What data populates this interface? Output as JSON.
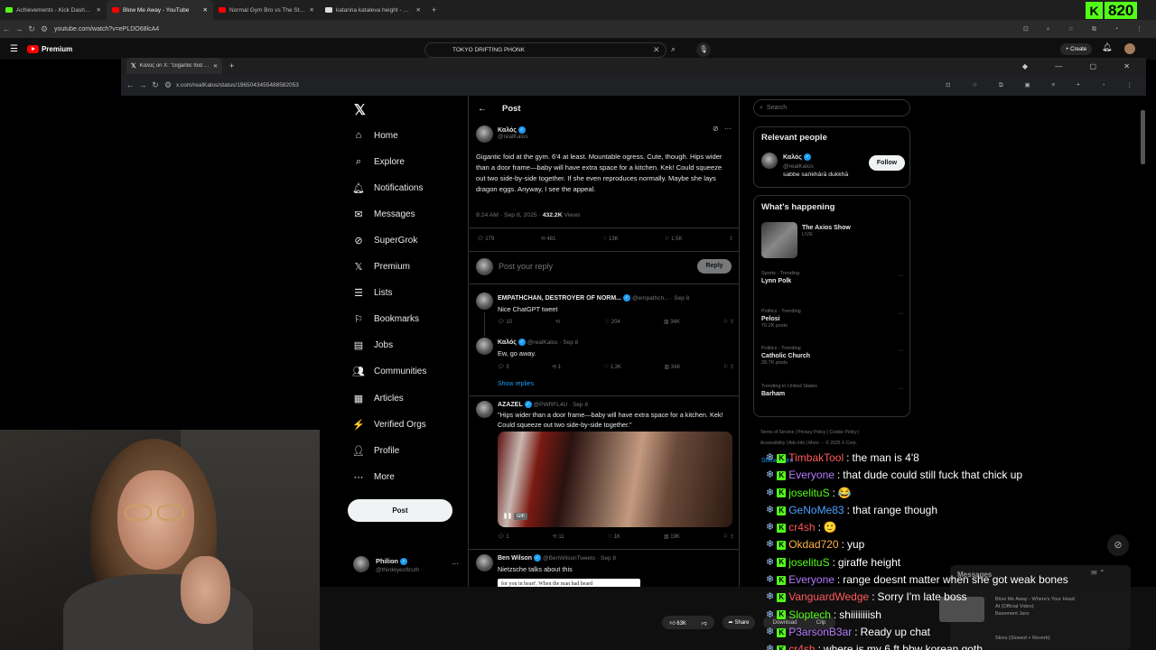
{
  "outer_tabs": [
    {
      "title": "Achievements - Kick Dashboard",
      "color": "#53fc18",
      "active": false
    },
    {
      "title": "Blow Me Away - YouTube",
      "color": "#ff0000",
      "active": true
    },
    {
      "title": "Normal Gym Bro vs The Strong...",
      "color": "#ff0000",
      "active": false
    },
    {
      "title": "katarina kataleva height - Goo...",
      "color": "#ddd",
      "active": false
    }
  ],
  "outer_url": "youtube.com/watch?v=ePLDO68lcA4",
  "kick": {
    "logo": "K",
    "count": "820"
  },
  "youtube": {
    "brand": "Premium",
    "search_value": "TOKYO DRIFTING PHONK",
    "create_label": "Create"
  },
  "inner_tab": {
    "title": "Καλός on X: \"Gigantic foid at th..."
  },
  "inner_url": "x.com/realKalos/status/1965043455488582053",
  "xnav": {
    "items": [
      "Home",
      "Explore",
      "Notifications",
      "Messages",
      "SuperGrok",
      "Premium",
      "Lists",
      "Bookmarks",
      "Jobs",
      "Communities",
      "Articles",
      "Verified Orgs",
      "Profile",
      "More"
    ],
    "post_button": "Post"
  },
  "account": {
    "name": "Philion",
    "handle": "@thirdeyeoftruth"
  },
  "post": {
    "header": "Post",
    "author": "Καλός",
    "handle": "@realKalos",
    "text": "Gigantic foid at the gym. 6'4 at least. Mountable ogress. Cute, though. Hips wider than a door frame—baby will have extra space for a kitchen. Kek! Could squeeze out two side-by-side together. If she even reproduces normally. Maybe she lays dragon eggs. Anyway, I see the appeal.",
    "time": "9:24 AM · Sep 8, 2025 · ",
    "views": "432.2K",
    "views_label": " Views",
    "replies": "179",
    "reposts": "481",
    "likes": "13K",
    "bookmarks": "1.5K",
    "reply_placeholder": "Post your reply",
    "reply_button": "Reply"
  },
  "replies": [
    {
      "name": "EMPATHCHAN, DESTROYER OF NORM...",
      "handle": "@empathch... · Sep 8",
      "text": "Nice ChatGPT tweet",
      "c": "10",
      "r": "",
      "l": "204",
      "v": "34K"
    },
    {
      "name": "Καλός",
      "handle": "@realKalos · Sep 8",
      "text": "Ew, go away.",
      "c": "3",
      "r": "1",
      "l": "1.3K",
      "v": "34K",
      "show_replies": "Show replies"
    },
    {
      "name": "AZAZEL",
      "handle": "@PWRFL4U · Sep 8",
      "text": "\"Hips wider than a door frame—baby will have extra space for a kitchen. Kek! Could squeeze out two side-by-side together.\"",
      "gif": "GIF",
      "c": "1",
      "r": "11",
      "l": "1K",
      "v": "19K"
    },
    {
      "name": "Ben Wilson",
      "handle": "@BenWilsonTweets · Sep 8",
      "text": "Nietzsche talks about this",
      "quote": "for you in heart'. When the man had heard"
    }
  ],
  "right": {
    "search_placeholder": "Search",
    "relevant_title": "Relevant people",
    "person": {
      "name": "Καλός",
      "handle": "@realKalos",
      "bio": "sabbe saṅkhārā dukkhā",
      "follow": "Follow"
    },
    "happening_title": "What's happening",
    "live": {
      "title": "The Axios Show",
      "status": "LIVE"
    },
    "trends": [
      {
        "category": "Sports · Trending",
        "name": "Lynn Polk",
        "posts": ""
      },
      {
        "category": "Politics · Trending",
        "name": "Pelosi",
        "posts": "70.2K posts"
      },
      {
        "category": "Politics · Trending",
        "name": "Catholic Church",
        "posts": "28.7K posts"
      },
      {
        "category": "Trending in United States",
        "name": "Barham",
        "posts": ""
      }
    ],
    "show_more": "Show more",
    "footer1": "Terms of Service  |  Privacy Policy  |  Cookie Policy  |",
    "footer2": "Accessibility  |  Ads info  |  More ···  © 2025 X Corp."
  },
  "chat": [
    {
      "user": "TimbakTool",
      "color": "#ff5a5a",
      "msg": "the man is 4'8"
    },
    {
      "user": "Everyone",
      "color": "#b57bff",
      "msg": "that dude could still fuck that chick up"
    },
    {
      "user": "joselituS",
      "color": "#53fc18",
      "msg": "😂"
    },
    {
      "user": "GeNoMe83",
      "color": "#4aa3ff",
      "msg": "that range though"
    },
    {
      "user": "cr4sh",
      "color": "#ff5a5a",
      "msg": "🙂"
    },
    {
      "user": "Okdad720",
      "color": "#ffb347",
      "msg": "yup"
    },
    {
      "user": "joselituS",
      "color": "#53fc18",
      "msg": "giraffe height"
    },
    {
      "user": "Everyone",
      "color": "#b57bff",
      "msg": "range doesnt matter when she got weak bones"
    },
    {
      "user": "VanguardWedge",
      "color": "#ff5a5a",
      "msg": "Sorry I'm late boss"
    },
    {
      "user": "Sloptech",
      "color": "#53fc18",
      "msg": "shiiiiiiiish"
    },
    {
      "user": "P3arsonB3ar",
      "color": "#b57bff",
      "msg": "Ready up chat"
    },
    {
      "user": "cr4sh",
      "color": "#ff5a5a",
      "msg": "where is my 6 ft bbw korean goth"
    }
  ],
  "yt_bottom": {
    "likes": "63K",
    "share": "Share",
    "download": "Download",
    "clip": "Clip"
  },
  "yt_side": {
    "messages": "Messages",
    "next_title": "Blow Me Away - Where's Your Head At (Official Video)",
    "next_sub": "Basement Jaxx",
    "next2": "Skins (Slowed + Reverb)"
  }
}
